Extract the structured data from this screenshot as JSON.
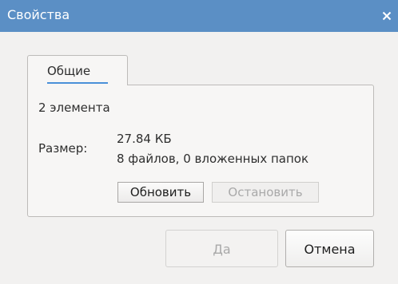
{
  "window": {
    "title": "Свойства",
    "close_icon": "close-icon"
  },
  "tabs": [
    {
      "label": "Общие",
      "active": true
    }
  ],
  "general": {
    "item_count": "2 элемента",
    "size_label": "Размер:",
    "size_value": "27.84 КБ",
    "size_details": "8 файлов, 0 вложенных папок",
    "refresh_label": "Обновить",
    "stop_label": "Остановить",
    "stop_enabled": false
  },
  "buttons": {
    "ok_label": "Да",
    "ok_enabled": false,
    "cancel_label": "Отмена"
  },
  "colors": {
    "titlebar": "#5b8fc5",
    "tab_underline": "#4a90d9",
    "window_bg": "#f2f1f0"
  }
}
